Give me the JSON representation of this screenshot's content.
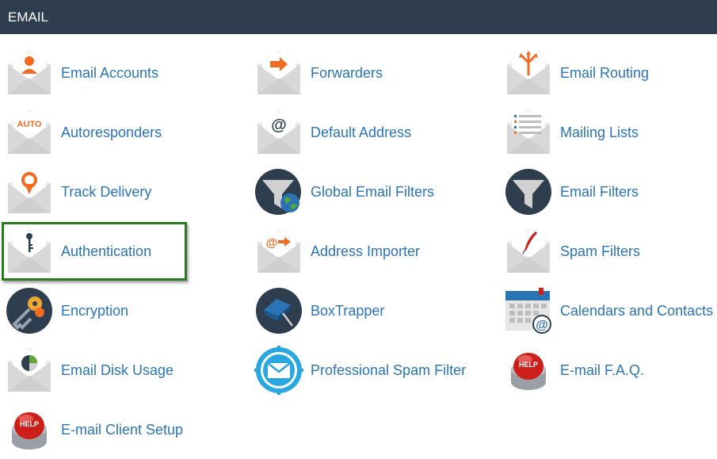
{
  "section": {
    "title": "EMAIL"
  },
  "items": [
    {
      "label": "Email Accounts",
      "icon": "envelope-user-icon"
    },
    {
      "label": "Forwarders",
      "icon": "envelope-arrow-icon"
    },
    {
      "label": "Email Routing",
      "icon": "envelope-routing-icon"
    },
    {
      "label": "Autoresponders",
      "icon": "envelope-auto-icon",
      "badge": "AUTO"
    },
    {
      "label": "Default Address",
      "icon": "envelope-at-icon",
      "badge": "@"
    },
    {
      "label": "Mailing Lists",
      "icon": "envelope-list-icon"
    },
    {
      "label": "Track Delivery",
      "icon": "envelope-location-pin-icon"
    },
    {
      "label": "Global Email Filters",
      "icon": "funnel-globe-icon"
    },
    {
      "label": "Email Filters",
      "icon": "funnel-icon"
    },
    {
      "label": "Authentication",
      "icon": "envelope-key-icon"
    },
    {
      "label": "Address Importer",
      "icon": "envelope-at-arrow-icon",
      "badge": "@"
    },
    {
      "label": "Spam Filters",
      "icon": "envelope-quill-icon"
    },
    {
      "label": "Encryption",
      "icon": "keys-icon"
    },
    {
      "label": "BoxTrapper",
      "icon": "box-trap-icon"
    },
    {
      "label": "Calendars and Contacts",
      "icon": "calendar-at-icon",
      "badge": "@"
    },
    {
      "label": "Email Disk Usage",
      "icon": "envelope-pie-chart-icon"
    },
    {
      "label": "Professional Spam Filter",
      "icon": "spam-filter-envelope-icon"
    },
    {
      "label": "E-mail F.A.Q.",
      "icon": "help-button-icon",
      "badge": "HELP"
    },
    {
      "label": "E-mail Client Setup",
      "icon": "help-button-icon",
      "badge": "HELP"
    }
  ],
  "selected_item": "Authentication",
  "colors": {
    "header_bg": "#2f3e4e",
    "link": "#2a74b6",
    "accent_orange": "#f26b21",
    "selection_border": "#2a7a1f",
    "dark_circle": "#2f3e4e",
    "help_red": "#cc1f1a"
  }
}
